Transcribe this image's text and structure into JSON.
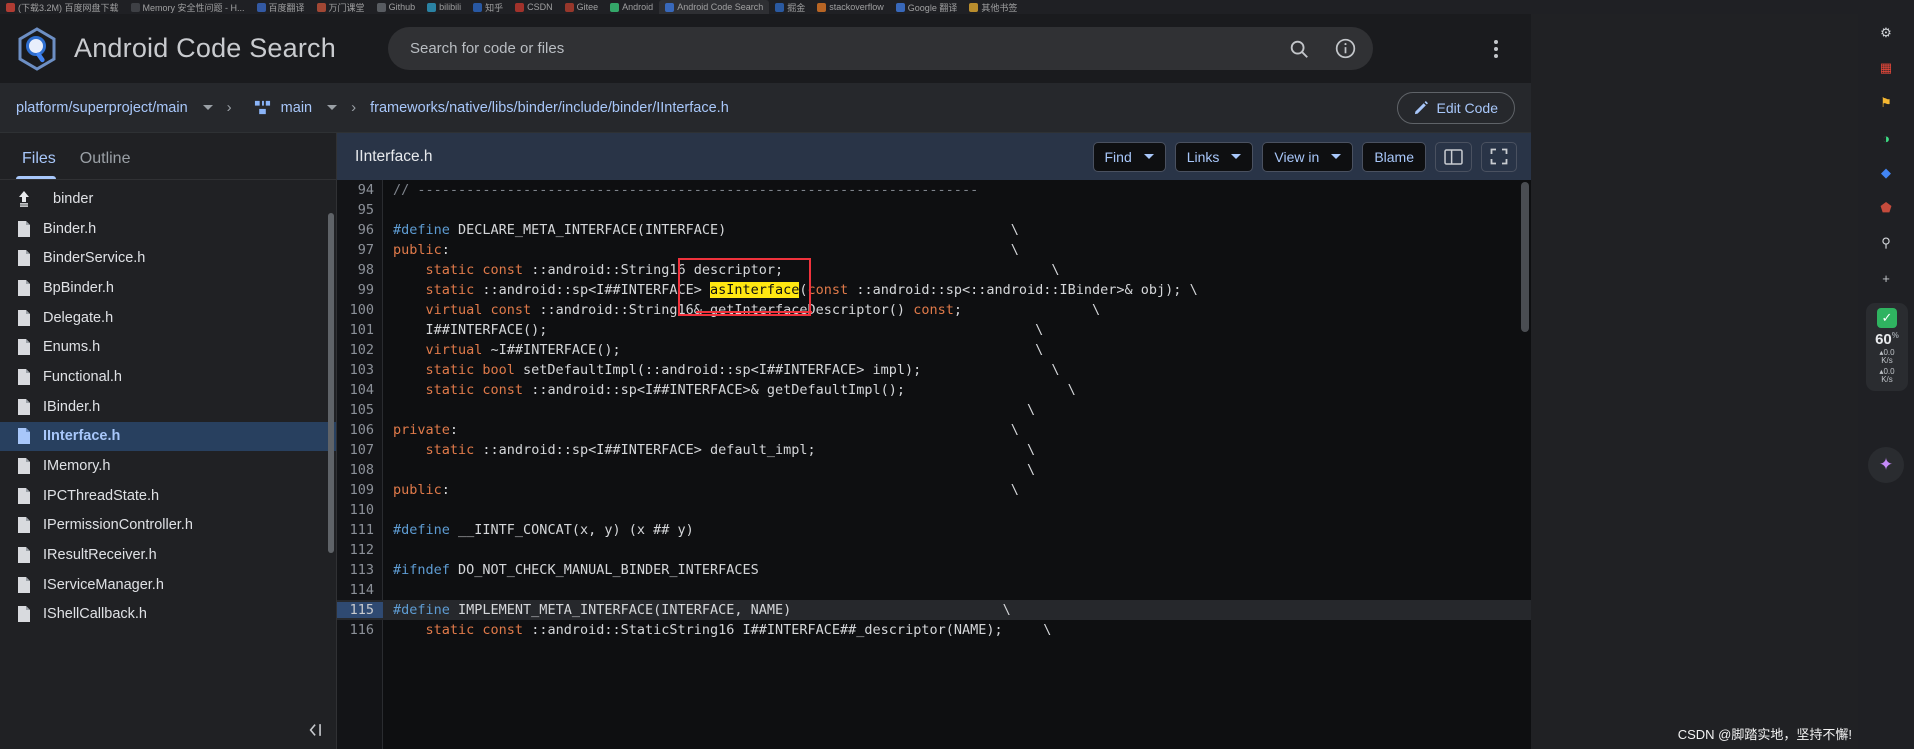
{
  "os_taskbar": {
    "items": [
      {
        "label": "(下载3.2M) 百度网盘下载",
        "color": "#e8483a"
      },
      {
        "label": "Memory 安全性问题 - H...",
        "color": "#4a4d52"
      },
      {
        "label": "百度翻译",
        "color": "#3b6fd4"
      },
      {
        "label": "万门课堂",
        "color": "#d4563b"
      },
      {
        "label": "Github",
        "color": "#6f7379"
      },
      {
        "label": "bilibili",
        "color": "#2fa8d4"
      },
      {
        "label": "知乎",
        "color": "#2c6ed5"
      },
      {
        "label": "CSDN",
        "color": "#d4392f"
      },
      {
        "label": "Gitee",
        "color": "#c6402f"
      },
      {
        "label": "Android",
        "color": "#3ddc84"
      },
      {
        "label": "Android Code Search",
        "color": "#4285f4",
        "active": true
      },
      {
        "label": "掘金",
        "color": "#2f6fd0"
      },
      {
        "label": "stackoverflow",
        "color": "#f48024"
      },
      {
        "label": "Google 翻译",
        "color": "#4285f4"
      },
      {
        "label": "其他书签",
        "color": "#f5b731"
      }
    ]
  },
  "header": {
    "brand": "Android Code Search",
    "logo_icon": "android-code-search-logo",
    "search": {
      "placeholder": "Search for code or files",
      "value": "",
      "search_icon": "search-icon",
      "info_icon": "info-icon"
    },
    "overflow_icon": "kebab-menu-icon"
  },
  "breadcrumb": {
    "repo": "platform/superproject/main",
    "repo_caret_icon": "chevron-down-icon",
    "separator": "›",
    "branch_icon": "branch-icon",
    "branch": "main",
    "branch_caret_icon": "chevron-down-icon",
    "path": "frameworks/native/libs/binder/include/binder/IInterface.h",
    "edit_button": {
      "label": "Edit Code",
      "icon": "pencil-icon"
    }
  },
  "sidebar": {
    "tabs": [
      {
        "label": "Files",
        "active": true
      },
      {
        "label": "Outline",
        "active": false
      }
    ],
    "collapse_icon": "collapse-panel-icon",
    "files": [
      {
        "name": "binder",
        "icon": "parent-folder-icon",
        "selected": false
      },
      {
        "name": "Binder.h",
        "icon": "file-icon",
        "selected": false
      },
      {
        "name": "BinderService.h",
        "icon": "file-icon",
        "selected": false
      },
      {
        "name": "BpBinder.h",
        "icon": "file-icon",
        "selected": false
      },
      {
        "name": "Delegate.h",
        "icon": "file-icon",
        "selected": false
      },
      {
        "name": "Enums.h",
        "icon": "file-icon",
        "selected": false
      },
      {
        "name": "Functional.h",
        "icon": "file-icon",
        "selected": false
      },
      {
        "name": "IBinder.h",
        "icon": "file-icon",
        "selected": false
      },
      {
        "name": "IInterface.h",
        "icon": "file-icon",
        "selected": true
      },
      {
        "name": "IMemory.h",
        "icon": "file-icon",
        "selected": false
      },
      {
        "name": "IPCThreadState.h",
        "icon": "file-icon",
        "selected": false
      },
      {
        "name": "IPermissionController.h",
        "icon": "file-icon",
        "selected": false
      },
      {
        "name": "IResultReceiver.h",
        "icon": "file-icon",
        "selected": false
      },
      {
        "name": "IServiceManager.h",
        "icon": "file-icon",
        "selected": false
      },
      {
        "name": "IShellCallback.h",
        "icon": "file-icon",
        "selected": false
      }
    ]
  },
  "editor": {
    "filename": "IInterface.h",
    "toolbar": [
      {
        "label": "Find",
        "caret": true,
        "name": "find-button"
      },
      {
        "label": "Links",
        "caret": true,
        "name": "links-button"
      },
      {
        "label": "View in",
        "caret": true,
        "name": "view-in-button"
      },
      {
        "label": "Blame",
        "caret": false,
        "name": "blame-button"
      }
    ],
    "split_view_icon": "split-view-icon",
    "fullscreen_icon": "fullscreen-icon",
    "current_line": 115,
    "highlight_term": "asInterface",
    "annotations": {
      "red_box_label": "red-rectangle-annotation",
      "strikethrough_label": "red-strikethrough-annotation"
    },
    "lines": [
      {
        "n": 94,
        "tokens": [
          {
            "t": "// ---------------------------------------------------------------------",
            "c": "cmt"
          }
        ]
      },
      {
        "n": 95,
        "tokens": [
          {
            "t": "",
            "c": ""
          }
        ]
      },
      {
        "n": 96,
        "tokens": [
          {
            "t": "#define",
            "c": "pp"
          },
          {
            "t": " DECLARE_META_INTERFACE(INTERFACE)",
            "c": ""
          },
          {
            "t": "                                   \\",
            "c": "cont"
          }
        ]
      },
      {
        "n": 97,
        "tokens": [
          {
            "t": "public",
            "c": "kw"
          },
          {
            "t": ":",
            "c": ""
          },
          {
            "t": "                                                                     \\",
            "c": "cont"
          }
        ]
      },
      {
        "n": 98,
        "tokens": [
          {
            "t": "    ",
            "c": ""
          },
          {
            "t": "static const",
            "c": "kw"
          },
          {
            "t": " ::android::String16 descriptor;",
            "c": ""
          },
          {
            "t": "                                 \\",
            "c": "cont"
          }
        ]
      },
      {
        "n": 99,
        "tokens": [
          {
            "t": "    ",
            "c": ""
          },
          {
            "t": "static",
            "c": "kw"
          },
          {
            "t": " ::android::sp<I##INTERFACE> ",
            "c": ""
          },
          {
            "t": "asInterface",
            "c": "hl"
          },
          {
            "t": "(",
            "c": ""
          },
          {
            "t": "const",
            "c": "kw"
          },
          {
            "t": " ::android::sp<::android::IBinder>& obj);",
            "c": ""
          },
          {
            "t": " \\",
            "c": "cont"
          }
        ]
      },
      {
        "n": 100,
        "tokens": [
          {
            "t": "    ",
            "c": ""
          },
          {
            "t": "virtual const",
            "c": "kw"
          },
          {
            "t": " ::android::String16& getInterfaceDescriptor() ",
            "c": ""
          },
          {
            "t": "const",
            "c": "kw"
          },
          {
            "t": ";",
            "c": ""
          },
          {
            "t": "                \\",
            "c": "cont"
          }
        ]
      },
      {
        "n": 101,
        "tokens": [
          {
            "t": "    I##INTERFACE();",
            "c": ""
          },
          {
            "t": "                                                            \\",
            "c": "cont"
          }
        ]
      },
      {
        "n": 102,
        "tokens": [
          {
            "t": "    ",
            "c": ""
          },
          {
            "t": "virtual",
            "c": "kw"
          },
          {
            "t": " ~I##INTERFACE();",
            "c": ""
          },
          {
            "t": "                                                   \\",
            "c": "cont"
          }
        ]
      },
      {
        "n": 103,
        "tokens": [
          {
            "t": "    ",
            "c": ""
          },
          {
            "t": "static bool",
            "c": "kw"
          },
          {
            "t": " setDefaultImpl(::android::sp<I##INTERFACE> impl);",
            "c": ""
          },
          {
            "t": "                \\",
            "c": "cont"
          }
        ]
      },
      {
        "n": 104,
        "tokens": [
          {
            "t": "    ",
            "c": ""
          },
          {
            "t": "static const",
            "c": "kw"
          },
          {
            "t": " ::android::sp<I##INTERFACE>& getDefaultImpl();",
            "c": ""
          },
          {
            "t": "                    \\",
            "c": "cont"
          }
        ]
      },
      {
        "n": 105,
        "tokens": [
          {
            "t": "",
            "c": ""
          },
          {
            "t": "                                                                              \\",
            "c": "cont"
          }
        ]
      },
      {
        "n": 106,
        "tokens": [
          {
            "t": "private",
            "c": "kw"
          },
          {
            "t": ":",
            "c": ""
          },
          {
            "t": "                                                                    \\",
            "c": "cont"
          }
        ]
      },
      {
        "n": 107,
        "tokens": [
          {
            "t": "    ",
            "c": ""
          },
          {
            "t": "static",
            "c": "kw"
          },
          {
            "t": " ::android::sp<I##INTERFACE> default_impl;",
            "c": ""
          },
          {
            "t": "                          \\",
            "c": "cont"
          }
        ]
      },
      {
        "n": 108,
        "tokens": [
          {
            "t": "",
            "c": ""
          },
          {
            "t": "                                                                              \\",
            "c": "cont"
          }
        ]
      },
      {
        "n": 109,
        "tokens": [
          {
            "t": "public",
            "c": "kw"
          },
          {
            "t": ":",
            "c": ""
          },
          {
            "t": "                                                                     \\",
            "c": "cont"
          }
        ]
      },
      {
        "n": 110,
        "tokens": [
          {
            "t": "",
            "c": ""
          }
        ]
      },
      {
        "n": 111,
        "tokens": [
          {
            "t": "#define",
            "c": "pp"
          },
          {
            "t": " __IINTF_CONCAT(x, y) (x ## y)",
            "c": ""
          }
        ]
      },
      {
        "n": 112,
        "tokens": [
          {
            "t": "",
            "c": ""
          }
        ]
      },
      {
        "n": 113,
        "tokens": [
          {
            "t": "#ifndef",
            "c": "pp"
          },
          {
            "t": " DO_NOT_CHECK_MANUAL_BINDER_INTERFACES",
            "c": ""
          }
        ]
      },
      {
        "n": 114,
        "tokens": [
          {
            "t": "",
            "c": ""
          }
        ]
      },
      {
        "n": 115,
        "tokens": [
          {
            "t": "#define",
            "c": "pp"
          },
          {
            "t": " IMPLEMENT_META_INTERFACE(INTERFACE, NAME)",
            "c": ""
          },
          {
            "t": "                          \\",
            "c": "cont"
          }
        ]
      },
      {
        "n": 116,
        "tokens": [
          {
            "t": "    ",
            "c": ""
          },
          {
            "t": "static const",
            "c": "kw"
          },
          {
            "t": " ::android::StaticString16 I##INTERFACE##_descriptor(NAME);",
            "c": ""
          },
          {
            "t": "     \\",
            "c": "cont"
          }
        ]
      }
    ]
  },
  "rail": {
    "icons": [
      {
        "name": "extension-puzzle-icon",
        "glyph": "⚙",
        "color": "#d4d7db"
      },
      {
        "name": "app-grid-icon",
        "glyph": "▦",
        "color": "#e8483a"
      },
      {
        "name": "bookmark-icon",
        "glyph": "⚑",
        "color": "#f5b731"
      },
      {
        "name": "palette-icon",
        "glyph": "◑",
        "color": "#3ddc84"
      },
      {
        "name": "photos-icon",
        "glyph": "◆",
        "color": "#4285f4"
      },
      {
        "name": "shield-icon",
        "glyph": "⬟",
        "color": "#c54b3c"
      },
      {
        "name": "search-rail-icon",
        "glyph": "⚲",
        "color": "#d4d7db"
      },
      {
        "name": "add-icon",
        "glyph": "+",
        "color": "#c7cace"
      }
    ],
    "speed_widget": {
      "check_icon": "checkmark-icon",
      "value": "60",
      "unit": "%",
      "upload": {
        "value": "0.0",
        "unit": "K/s",
        "arrow": "▴"
      },
      "download": {
        "value": "0.0",
        "unit": "K/s",
        "arrow": "▴"
      }
    },
    "sparkle_icon": "sparkle-ai-icon"
  },
  "watermark": {
    "text": "CSDN @脚踏实地，坚持不懈!"
  }
}
